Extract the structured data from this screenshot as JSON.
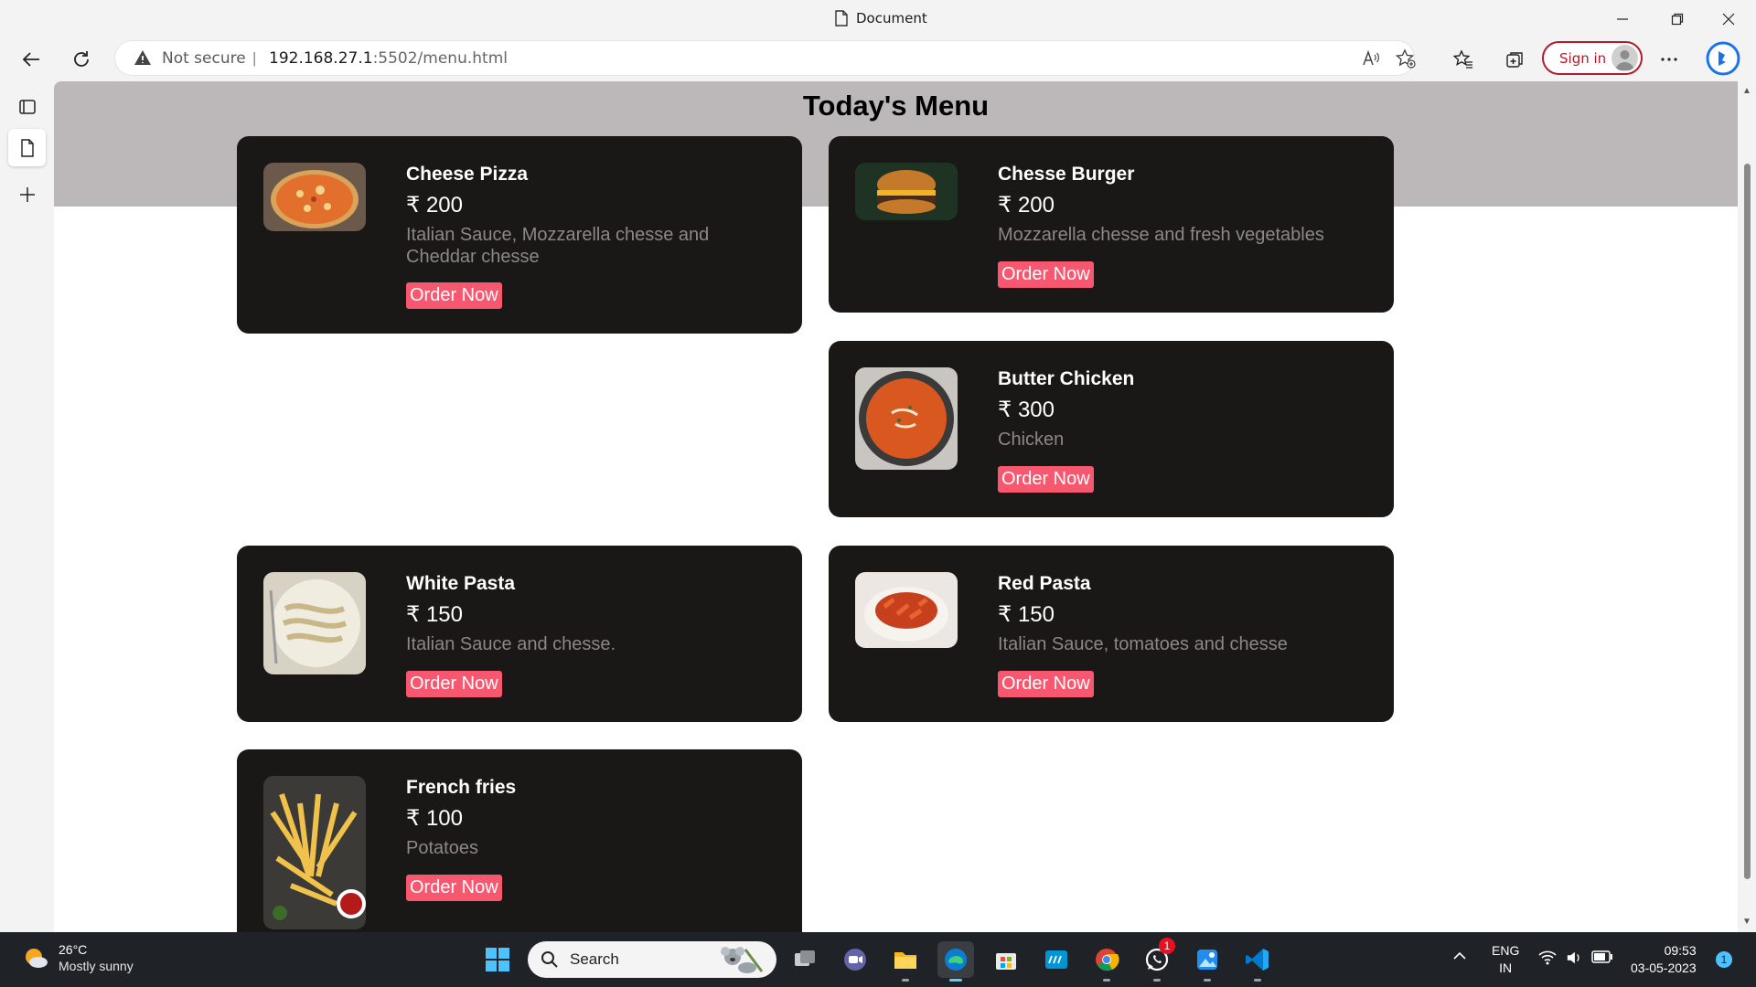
{
  "window": {
    "title": "Document"
  },
  "toolbar": {
    "security_label": "Not secure",
    "separator": "|",
    "url_host": "192.168.27.1",
    "url_rest": ":5502/menu.html",
    "signin_label": "Sign in"
  },
  "page": {
    "title": "Today's Menu",
    "items": [
      {
        "name": "Cheese Pizza",
        "price": "₹ 200",
        "description": "Italian Sauce, Mozzarella chesse and Cheddar chesse",
        "order_label": "Order Now"
      },
      {
        "name": "Chesse Burger",
        "price": "₹ 200",
        "description": "Mozzarella chesse and fresh vegetables",
        "order_label": "Order Now"
      },
      {
        "name": "Butter Chicken",
        "price": "₹ 300",
        "description": "Chicken",
        "order_label": "Order Now"
      },
      {
        "name": "White Pasta",
        "price": "₹ 150",
        "description": "Italian Sauce and chesse.",
        "order_label": "Order Now"
      },
      {
        "name": "Red Pasta",
        "price": "₹ 150",
        "description": "Italian Sauce, tomatoes and chesse",
        "order_label": "Order Now"
      },
      {
        "name": "French fries",
        "price": "₹ 100",
        "description": "Potatoes",
        "order_label": "Order Now"
      }
    ]
  },
  "taskbar": {
    "weather_temp": "26°C",
    "weather_desc": "Mostly sunny",
    "search_label": "Search",
    "whatsapp_badge": "1",
    "lang_line1": "ENG",
    "lang_line2": "IN",
    "time": "09:53",
    "date": "03-05-2023",
    "notification_count": "1"
  },
  "colors": {
    "card_bg": "#1a1717",
    "order_button": "#f7586f",
    "banner": "#bcb8b9",
    "signin_accent": "#b31b2c"
  }
}
